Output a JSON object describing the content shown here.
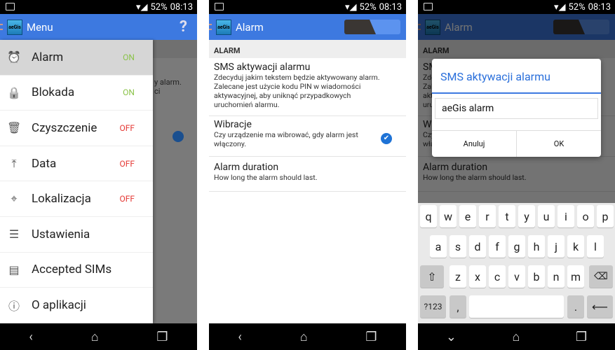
{
  "status": {
    "battery": "52%",
    "time": "08:13"
  },
  "logo_text": "aeGis",
  "panel1": {
    "title": "Menu",
    "help": "?",
    "items": [
      {
        "label": "Alarm",
        "state": "ON",
        "icon": "alarm-clock-icon"
      },
      {
        "label": "Blokada",
        "state": "ON",
        "icon": "lock-icon"
      },
      {
        "label": "Czyszczenie",
        "state": "OFF",
        "icon": "trash-icon"
      },
      {
        "label": "Data",
        "state": "OFF",
        "icon": "upload-icon"
      },
      {
        "label": "Lokalizacja",
        "state": "OFF",
        "icon": "location-icon"
      },
      {
        "label": "Ustawienia",
        "icon": "sliders-icon"
      },
      {
        "label": "Accepted SIMs",
        "icon": "sim-list-icon"
      },
      {
        "label": "O aplikacji",
        "icon": "info-icon"
      }
    ],
    "behind_text": "y alarm.\nci"
  },
  "panel2": {
    "title": "Alarm",
    "toggle_on": true,
    "section": "ALARM",
    "prefs": [
      {
        "title": "SMS aktywacji alarmu",
        "summary": "Zdecyduj jakim tekstem będzie aktywowany alarm. Zalecane jest użycie kodu PIN w wiadomości aktywacyjnej, aby uniknąć przypadkowych uruchomień alarmu."
      },
      {
        "title": "Wibracje",
        "summary": "Czy urządzenie ma wibrować, gdy alarm jest włączony.",
        "checked": true
      },
      {
        "title": "Alarm duration",
        "summary": "How long the alarm should last."
      }
    ]
  },
  "panel3": {
    "dialog": {
      "title": "SMS aktywacji alarmu",
      "value": "aeGis alarm",
      "cancel": "Anuluj",
      "ok": "OK"
    },
    "keyboard": {
      "row1": [
        "q",
        "w",
        "e",
        "r",
        "t",
        "y",
        "u",
        "i",
        "o",
        "p"
      ],
      "row2": [
        "a",
        "s",
        "d",
        "f",
        "g",
        "h",
        "j",
        "k",
        "l"
      ],
      "row3": [
        "z",
        "x",
        "c",
        "v",
        "b",
        "n",
        "m"
      ],
      "symbols": "?123",
      "comma": ",",
      "period": "."
    }
  },
  "colors": {
    "accent": "#3d79e0",
    "on": "#8bc34a",
    "off": "#e53935"
  }
}
